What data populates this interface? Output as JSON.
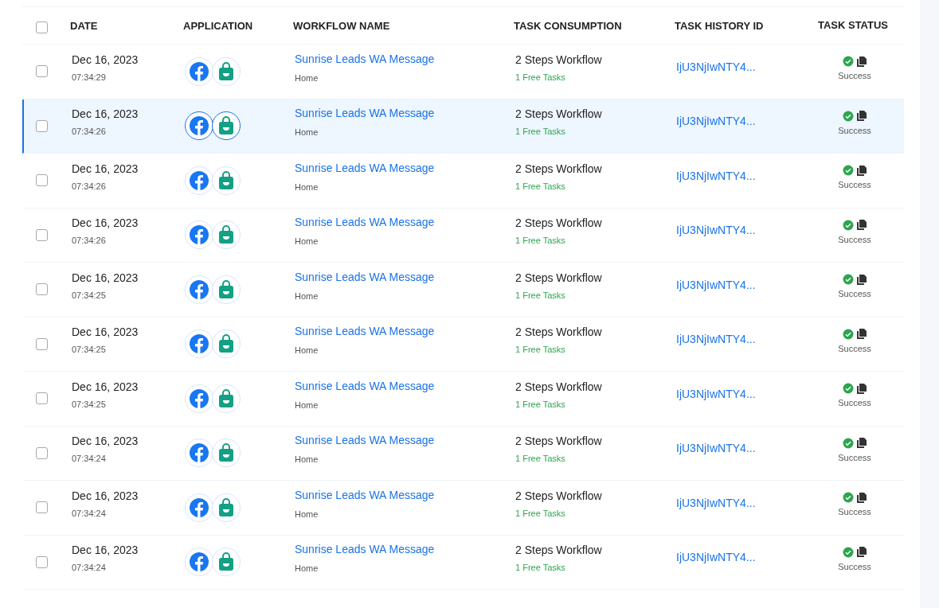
{
  "columns": [
    {
      "label": "DATE"
    },
    {
      "label": "APPLICATION"
    },
    {
      "label": "WORKFLOW NAME"
    },
    {
      "label": "TASK CONSUMPTION"
    },
    {
      "label": "TASK HISTORY ID"
    },
    {
      "label": "TASK STATUS"
    }
  ],
  "header_checkbox": {
    "checked": false
  },
  "rows": [
    {
      "selected": false,
      "checked": false,
      "date": "Dec 16, 2023",
      "time": "07:34:29",
      "apps": [
        {
          "kind": "facebook"
        },
        {
          "kind": "bag"
        }
      ],
      "workflow": "Sunrise Leads WA Message",
      "folder": "Home",
      "consumption": "2 Steps Workflow",
      "free_tasks": "1 Free Tasks",
      "history_id": "IjU3NjIwNTY4...",
      "status": {
        "kind": "success",
        "label": "Success"
      }
    },
    {
      "selected": true,
      "checked": false,
      "date": "Dec 16, 2023",
      "time": "07:34:26",
      "apps": [
        {
          "kind": "facebook"
        },
        {
          "kind": "bag"
        }
      ],
      "workflow": "Sunrise Leads WA Message",
      "folder": "Home",
      "consumption": "2 Steps Workflow",
      "free_tasks": "1 Free Tasks",
      "history_id": "IjU3NjIwNTY4...",
      "status": {
        "kind": "success",
        "label": "Success"
      }
    },
    {
      "selected": false,
      "checked": false,
      "date": "Dec 16, 2023",
      "time": "07:34:26",
      "apps": [
        {
          "kind": "facebook"
        },
        {
          "kind": "bag"
        }
      ],
      "workflow": "Sunrise Leads WA Message",
      "folder": "Home",
      "consumption": "2 Steps Workflow",
      "free_tasks": "1 Free Tasks",
      "history_id": "IjU3NjIwNTY4...",
      "status": {
        "kind": "success",
        "label": "Success"
      }
    },
    {
      "selected": false,
      "checked": false,
      "date": "Dec 16, 2023",
      "time": "07:34:26",
      "apps": [
        {
          "kind": "facebook"
        },
        {
          "kind": "bag"
        }
      ],
      "workflow": "Sunrise Leads WA Message",
      "folder": "Home",
      "consumption": "2 Steps Workflow",
      "free_tasks": "1 Free Tasks",
      "history_id": "IjU3NjIwNTY4...",
      "status": {
        "kind": "success",
        "label": "Success"
      }
    },
    {
      "selected": false,
      "checked": false,
      "date": "Dec 16, 2023",
      "time": "07:34:25",
      "apps": [
        {
          "kind": "facebook"
        },
        {
          "kind": "bag"
        }
      ],
      "workflow": "Sunrise Leads WA Message",
      "folder": "Home",
      "consumption": "2 Steps Workflow",
      "free_tasks": "1 Free Tasks",
      "history_id": "IjU3NjIwNTY4...",
      "status": {
        "kind": "success",
        "label": "Success"
      }
    },
    {
      "selected": false,
      "checked": false,
      "date": "Dec 16, 2023",
      "time": "07:34:25",
      "apps": [
        {
          "kind": "facebook"
        },
        {
          "kind": "bag"
        }
      ],
      "workflow": "Sunrise Leads WA Message",
      "folder": "Home",
      "consumption": "2 Steps Workflow",
      "free_tasks": "1 Free Tasks",
      "history_id": "IjU3NjIwNTY4...",
      "status": {
        "kind": "success",
        "label": "Success"
      }
    },
    {
      "selected": false,
      "checked": false,
      "date": "Dec 16, 2023",
      "time": "07:34:25",
      "apps": [
        {
          "kind": "facebook"
        },
        {
          "kind": "bag"
        }
      ],
      "workflow": "Sunrise Leads WA Message",
      "folder": "Home",
      "consumption": "2 Steps Workflow",
      "free_tasks": "1 Free Tasks",
      "history_id": "IjU3NjIwNTY4...",
      "status": {
        "kind": "success",
        "label": "Success"
      }
    },
    {
      "selected": false,
      "checked": false,
      "date": "Dec 16, 2023",
      "time": "07:34:24",
      "apps": [
        {
          "kind": "facebook"
        },
        {
          "kind": "bag"
        }
      ],
      "workflow": "Sunrise Leads WA Message",
      "folder": "Home",
      "consumption": "2 Steps Workflow",
      "free_tasks": "1 Free Tasks",
      "history_id": "IjU3NjIwNTY4...",
      "status": {
        "kind": "success",
        "label": "Success"
      }
    },
    {
      "selected": false,
      "checked": false,
      "date": "Dec 16, 2023",
      "time": "07:34:24",
      "apps": [
        {
          "kind": "facebook"
        },
        {
          "kind": "bag"
        }
      ],
      "workflow": "Sunrise Leads WA Message",
      "folder": "Home",
      "consumption": "2 Steps Workflow",
      "free_tasks": "1 Free Tasks",
      "history_id": "IjU3NjIwNTY4...",
      "status": {
        "kind": "success",
        "label": "Success"
      }
    },
    {
      "selected": false,
      "checked": false,
      "date": "Dec 16, 2023",
      "time": "07:34:24",
      "apps": [
        {
          "kind": "facebook"
        },
        {
          "kind": "bag"
        }
      ],
      "workflow": "Sunrise Leads WA Message",
      "folder": "Home",
      "consumption": "2 Steps Workflow",
      "free_tasks": "1 Free Tasks",
      "history_id": "IjU3NjIwNTY4...",
      "status": {
        "kind": "success",
        "label": "Success"
      }
    }
  ]
}
